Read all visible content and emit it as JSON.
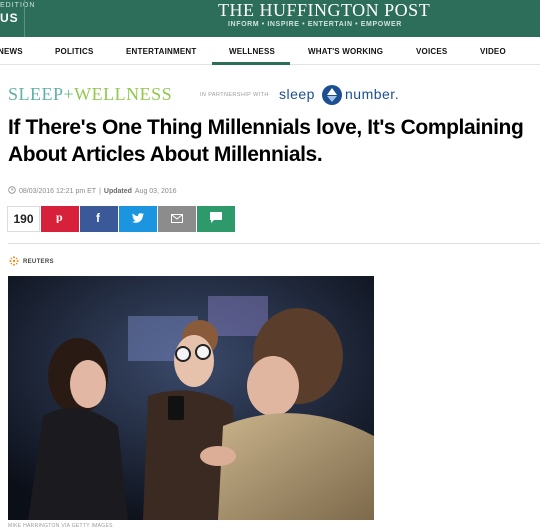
{
  "header": {
    "edition_label": "EDITION",
    "edition_value": "US",
    "brand": "THE HUFFINGTON POST",
    "tagline": "INFORM • INSPIRE • ENTERTAIN • EMPOWER",
    "bg_color": "#2c6e5a"
  },
  "nav": {
    "items": [
      "NEWS",
      "POLITICS",
      "ENTERTAINMENT",
      "WELLNESS",
      "WHAT'S WORKING",
      "VOICES",
      "VIDEO"
    ],
    "active": "WELLNESS"
  },
  "sponsor": {
    "section_sleep": "SLEEP",
    "section_plus": "+",
    "section_wellness": "WELLNESS",
    "partnership": "IN PARTNERSHIP WITH",
    "partner_sleep": "sleep",
    "partner_number": "number."
  },
  "article": {
    "headline": "If There's One Thing Millennials love, It's Complaining About Articles About Millennials.",
    "published": "08/03/2016 12:21 pm ET",
    "updated_label": "Updated",
    "updated": "Aug 03, 2016",
    "source": "REUTERS",
    "photo_credit": "MIKE HARRINGTON VIA GETTY IMAGES"
  },
  "share": {
    "count": "190",
    "buttons": [
      {
        "name": "pinterest",
        "icon": "pinterest-icon",
        "color": "#d7213b"
      },
      {
        "name": "facebook",
        "icon": "facebook-icon",
        "color": "#3b5998"
      },
      {
        "name": "twitter",
        "icon": "twitter-icon",
        "color": "#1b95e0"
      },
      {
        "name": "email",
        "icon": "mail-icon",
        "color": "#8c8c8c"
      },
      {
        "name": "comments",
        "icon": "comment-icon",
        "color": "#2e9a6b"
      }
    ]
  }
}
